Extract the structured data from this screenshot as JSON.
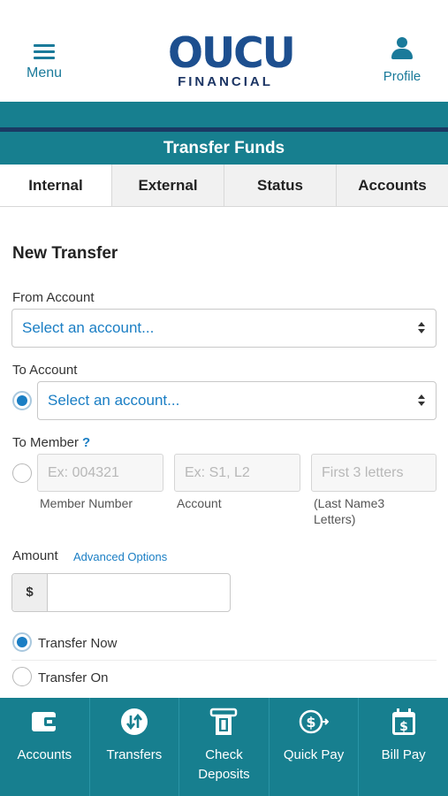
{
  "header": {
    "menu_label": "Menu",
    "logo_text": "OUCU",
    "logo_subtext": "FINANCIAL",
    "profile_label": "Profile"
  },
  "page": {
    "title": "Transfer Funds"
  },
  "tabs": [
    {
      "label": "Internal",
      "active": true
    },
    {
      "label": "External",
      "active": false
    },
    {
      "label": "Status",
      "active": false
    },
    {
      "label": "Accounts",
      "active": false
    }
  ],
  "form": {
    "section_title": "New Transfer",
    "from_account": {
      "label": "From Account",
      "value": "Select an account..."
    },
    "to_account": {
      "label": "To Account",
      "value": "Select an account...",
      "radio_selected": true
    },
    "to_member": {
      "label": "To Member",
      "help": "?",
      "radio_selected": false,
      "member_number_placeholder": "Ex: 004321",
      "account_placeholder": "Ex: S1, L2",
      "last_name_placeholder": "First  3  letters",
      "member_number_caption": "Member Number",
      "account_caption": "Account",
      "last_name_caption_line1": "(Last Name3",
      "last_name_caption_line2": "Letters)"
    },
    "amount": {
      "label": "Amount",
      "advanced_link": "Advanced Options",
      "currency_symbol": "$",
      "value": ""
    },
    "timing": {
      "transfer_now": "Transfer Now",
      "transfer_on": "Transfer On",
      "selected": "transfer_now"
    }
  },
  "bottom_nav": [
    {
      "label": "Accounts",
      "icon": "wallet-icon"
    },
    {
      "label": "Transfers",
      "icon": "transfer-arrows-icon"
    },
    {
      "label": "Check",
      "label2": "Deposits",
      "icon": "check-deposit-icon"
    },
    {
      "label": "Quick Pay",
      "icon": "quick-pay-icon"
    },
    {
      "label": "Bill Pay",
      "icon": "bill-pay-calendar-icon"
    }
  ],
  "colors": {
    "teal": "#177f8f",
    "navy": "#1a3a63",
    "link_blue": "#1a7ec4"
  }
}
